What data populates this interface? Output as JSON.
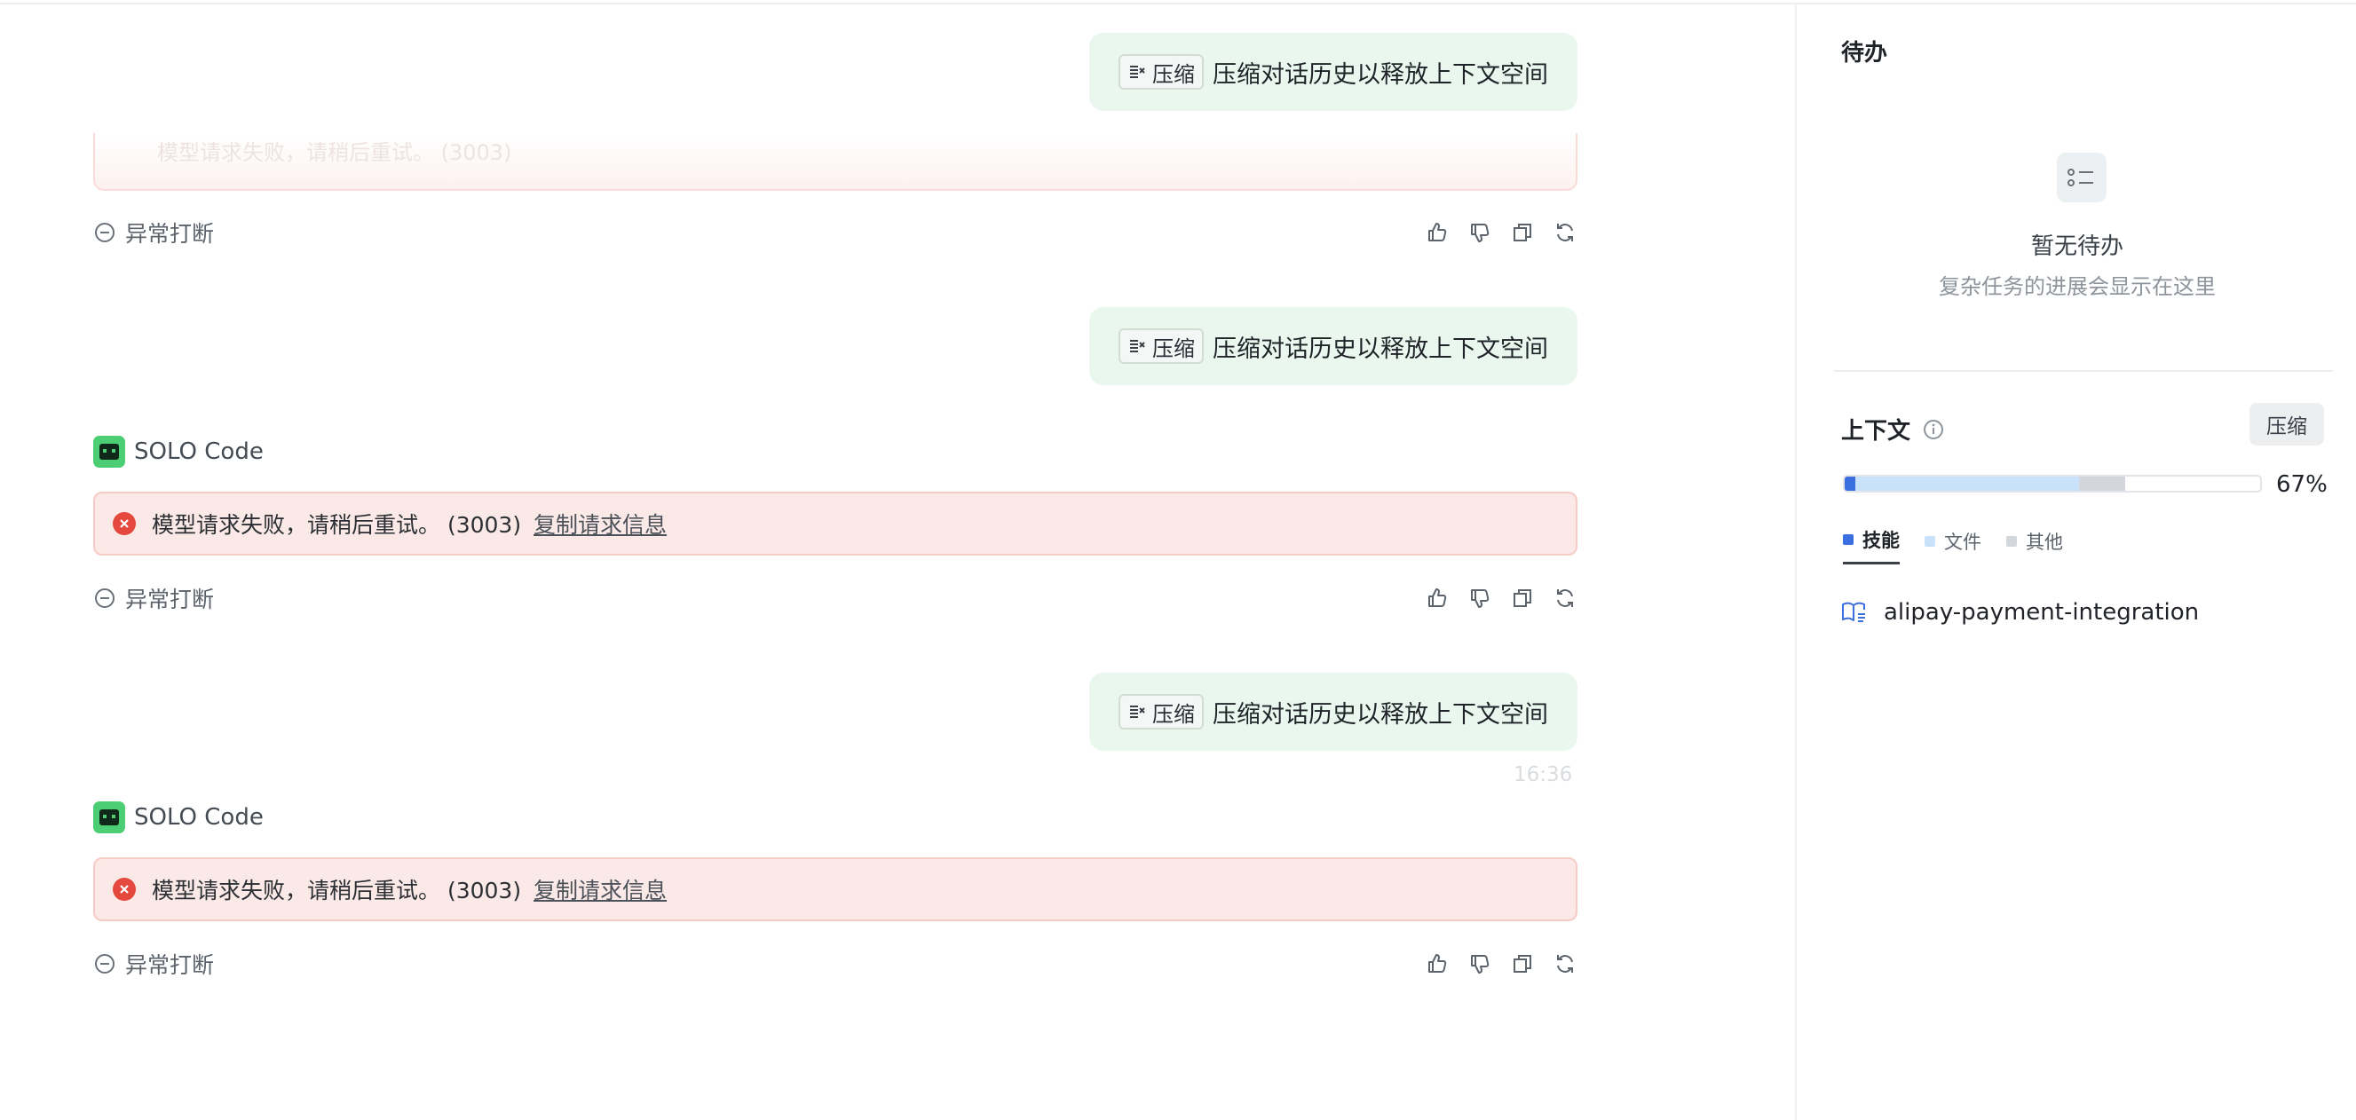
{
  "chat": {
    "messages": [
      {
        "role": "user",
        "tag": "压缩",
        "text": "压缩对话历史以释放上下文空间"
      },
      {
        "role": "status",
        "status_text": "异常打断"
      },
      {
        "role": "user",
        "tag": "压缩",
        "text": "压缩对话历史以释放上下文空间"
      },
      {
        "role": "agent",
        "agent_name": "SOLO Code",
        "error_text": "模型请求失败，请稍后重试。 (3003)",
        "error_link": "复制请求信息",
        "status_text": "异常打断"
      },
      {
        "role": "user",
        "tag": "压缩",
        "text": "压缩对话历史以释放上下文空间",
        "time": "16:36"
      },
      {
        "role": "agent",
        "agent_name": "SOLO Code",
        "error_text": "模型请求失败，请稍后重试。 (3003)",
        "error_link": "复制请求信息",
        "status_text": "异常打断"
      }
    ]
  },
  "panel": {
    "todo_title": "待办",
    "todo_empty_title": "暂无待办",
    "todo_empty_sub": "复杂任务的进展会显示在这里",
    "context_title": "上下文",
    "compress_label": "压缩",
    "context_percent_label": "67%",
    "context_usage": {
      "skills": 0.025,
      "files": 0.54,
      "other": 0.11
    },
    "legend": [
      {
        "label": "技能",
        "color": "#3b6fe0",
        "active": true
      },
      {
        "label": "文件",
        "color": "#c9e2fb",
        "active": false
      },
      {
        "label": "其他",
        "color": "#d3d6da",
        "active": false
      }
    ],
    "skill_item": "alipay-payment-integration"
  },
  "colors": {
    "user_bubble": "#e9f7ee",
    "error_bg": "#fbe9e7",
    "error_icon": "#e5483d",
    "agent_logo": "#4ccf74"
  },
  "icons": [
    "compress-icon",
    "solo-code-logo",
    "error-icon",
    "interrupt-icon",
    "thumbs-up-icon",
    "thumbs-down-icon",
    "copy-icon",
    "refresh-icon",
    "todo-list-icon",
    "info-icon",
    "book-icon"
  ]
}
